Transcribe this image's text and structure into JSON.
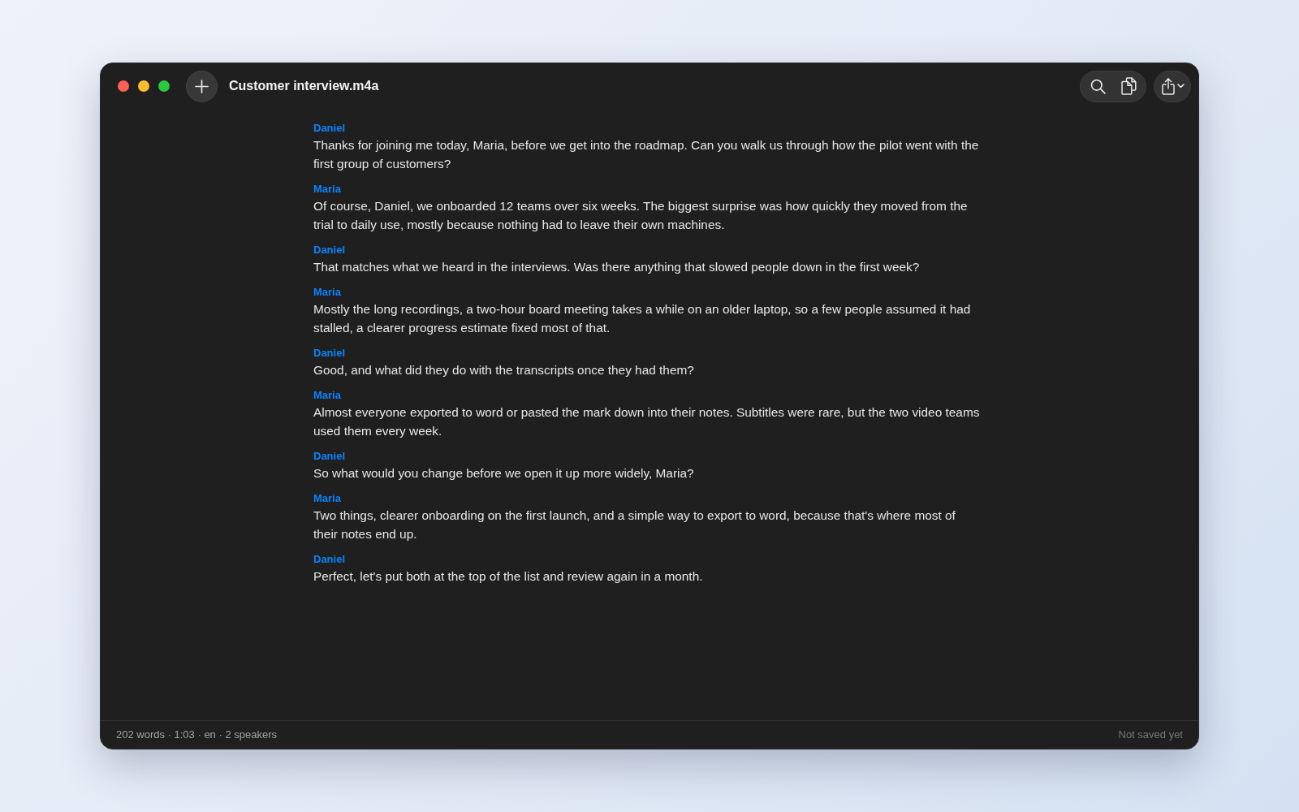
{
  "window": {
    "title": "Customer interview.m4a"
  },
  "transcript": [
    {
      "speaker": "Daniel",
      "text": "Thanks for joining me today, Maria, before we get into the roadmap. Can you walk us through how the pilot went with the first group of customers?"
    },
    {
      "speaker": "Maria",
      "text": "Of course, Daniel, we onboarded 12 teams over six weeks. The biggest surprise was how quickly they moved from the trial to daily use, mostly because nothing had to leave their own machines."
    },
    {
      "speaker": "Daniel",
      "text": "That matches what we heard in the interviews. Was there anything that slowed people down in the first week?"
    },
    {
      "speaker": "Maria",
      "text": "Mostly the long recordings, a two-hour board meeting takes a while on an older laptop, so a few people assumed it had stalled, a clearer progress estimate fixed most of that."
    },
    {
      "speaker": "Daniel",
      "text": "Good, and what did they do with the transcripts once they had them?"
    },
    {
      "speaker": "Maria",
      "text": "Almost everyone exported to word or pasted the mark down into their notes. Subtitles were rare, but the two video teams used them every week."
    },
    {
      "speaker": "Daniel",
      "text": "So what would you change before we open it up more widely, Maria?"
    },
    {
      "speaker": "Maria",
      "text": "Two things, clearer onboarding on the first launch, and a simple way to export to word, because that's where most of their notes end up."
    },
    {
      "speaker": "Daniel",
      "text": "Perfect, let's put both at the top of the list and review again in a month."
    }
  ],
  "status_bar": {
    "summary": "202 words · 1:03 · en · 2 speakers",
    "save_state": "Not saved yet"
  }
}
